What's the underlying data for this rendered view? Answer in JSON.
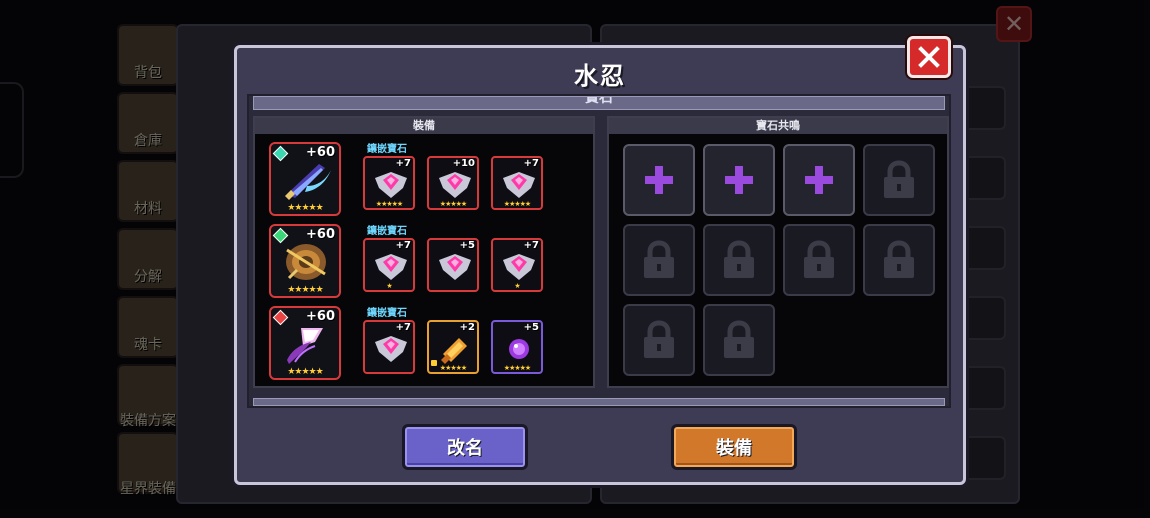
{
  "background": {
    "sidebar_items": [
      "背包",
      "倉庫",
      "材料",
      "分解",
      "魂卡",
      "裝備方案",
      "星界裝備"
    ]
  },
  "modal": {
    "title": "水忍",
    "section_tab": "寶石",
    "equipment_header": "裝備",
    "resonance_header": "寶石共鳴",
    "buttons": {
      "rename": "改名",
      "equip": "裝備"
    }
  },
  "equipment": [
    {
      "name": "weapon",
      "plus": "+60",
      "marker_color": "#3ad7b0",
      "inlay_label": "鑲嵌寶石",
      "gems": [
        {
          "plus": "+7"
        },
        {
          "plus": "+10"
        },
        {
          "plus": "+7"
        }
      ]
    },
    {
      "name": "armor",
      "plus": "+60",
      "marker_color": "#3ad77a",
      "inlay_label": "鑲嵌寶石",
      "gems": [
        {
          "plus": "+7"
        },
        {
          "plus": "+5"
        },
        {
          "plus": "+7"
        }
      ]
    },
    {
      "name": "accessory",
      "plus": "+60",
      "marker_color": "#e84444",
      "inlay_label": "鑲嵌寶石",
      "gems": [
        {
          "plus": "+7"
        },
        {
          "plus": "+2"
        },
        {
          "plus": "+5"
        }
      ]
    }
  ],
  "resonance_slots": [
    {
      "state": "unlocked",
      "icon": "plus-icon"
    },
    {
      "state": "unlocked",
      "icon": "plus-icon"
    },
    {
      "state": "unlocked",
      "icon": "plus-icon"
    },
    {
      "state": "locked",
      "icon": "lock-icon"
    },
    {
      "state": "locked",
      "icon": "lock-icon"
    },
    {
      "state": "locked",
      "icon": "lock-icon"
    },
    {
      "state": "locked",
      "icon": "lock-icon"
    },
    {
      "state": "locked",
      "icon": "lock-icon"
    },
    {
      "state": "locked",
      "icon": "lock-icon"
    },
    {
      "state": "locked",
      "icon": "lock-icon"
    }
  ],
  "colors": {
    "accent_red": "#d63a3a",
    "plus_purple": "#9a4adc",
    "rename_button": "#6a62c8",
    "equip_button": "#d2782a"
  }
}
